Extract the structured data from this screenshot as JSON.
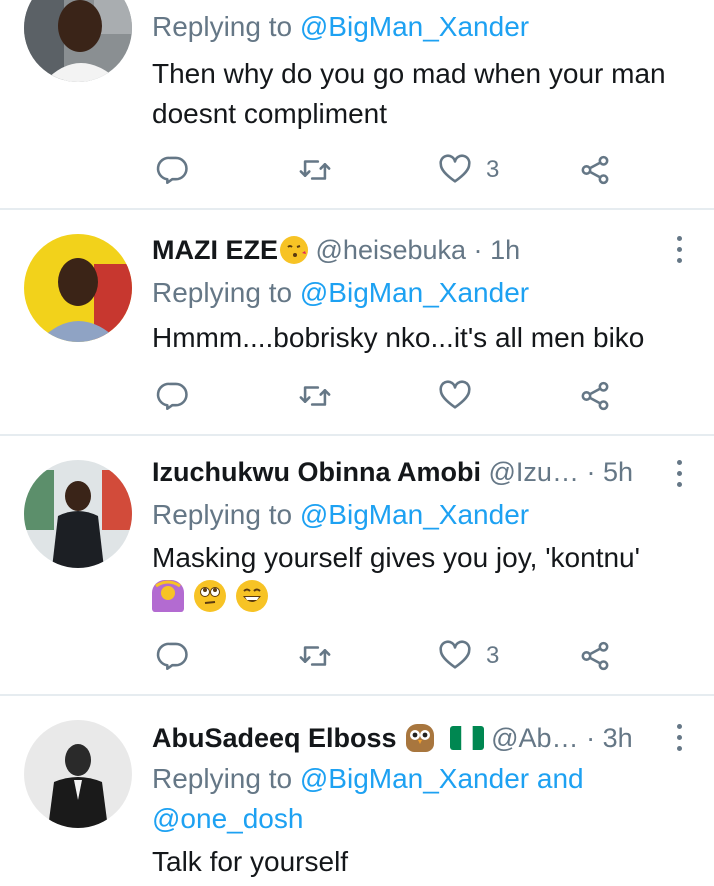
{
  "tweets": [
    {
      "replying_prefix": "Replying to",
      "replying_to": "@BigMan_Xander",
      "text_lines": [
        "Then why do you go mad when your man",
        "doesnt compliment"
      ],
      "likes": "3"
    },
    {
      "name": "MAZI EZE",
      "handle": "@heisebuka",
      "dot": "·",
      "time": "1h",
      "replying_prefix": "Replying to",
      "replying_to": "@BigMan_Xander",
      "text_lines": [
        "Hmmm....bobrisky nko...it's all men biko"
      ],
      "likes": ""
    },
    {
      "name": "Izuchukwu Obinna Amobi",
      "handle": "@Izu…",
      "dot": "·",
      "time": "5h",
      "replying_prefix": "Replying to",
      "replying_to": "@BigMan_Xander",
      "text_lines": [
        "Masking yourself gives you joy, 'kontnu'"
      ],
      "likes": "3"
    },
    {
      "name": "AbuSadeeq Elboss",
      "handle": "@Ab…",
      "dot": "·",
      "time": "3h",
      "replying_prefix": "Replying to",
      "replying_to": "@BigMan_Xander",
      "replying_and": "and",
      "replying_to_2": "@one_dosh",
      "text_lines": [
        "Talk for yourself"
      ]
    }
  ],
  "icons": {
    "reply": "reply-icon",
    "retweet": "retweet-icon",
    "like": "heart-icon",
    "share": "share-icon",
    "more": "more-vertical-icon"
  },
  "colors": {
    "mention": "#1da1f2",
    "secondary_text": "#657786",
    "divider": "#e6ecf0"
  }
}
